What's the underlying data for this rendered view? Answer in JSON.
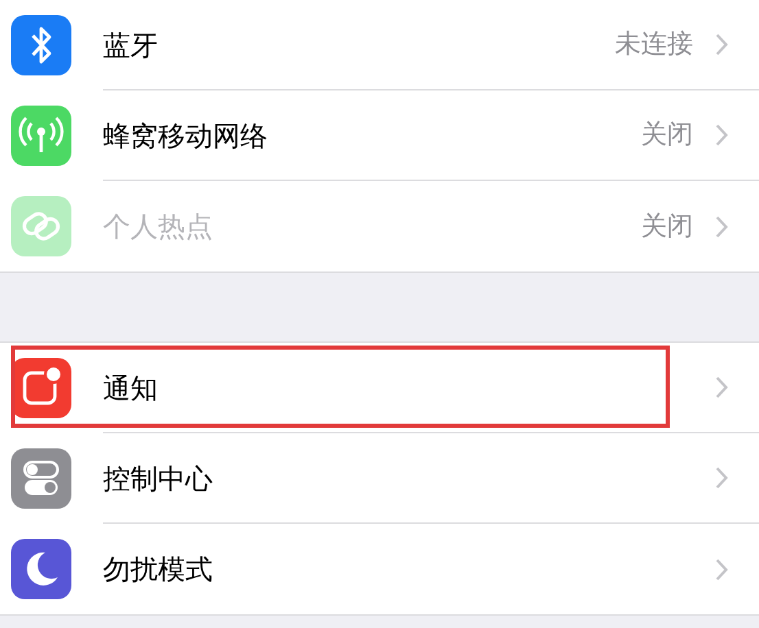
{
  "groups": [
    {
      "rows": [
        {
          "kind": "bluetooth",
          "label": "蓝牙",
          "value": "未连接",
          "disabled": false,
          "highlighted": false
        },
        {
          "kind": "cellular",
          "label": "蜂窝移动网络",
          "value": "关闭",
          "disabled": false,
          "highlighted": false
        },
        {
          "kind": "hotspot",
          "label": "个人热点",
          "value": "关闭",
          "disabled": true,
          "highlighted": false
        }
      ]
    },
    {
      "rows": [
        {
          "kind": "notifications",
          "label": "通知",
          "disabled": false,
          "highlighted": true
        },
        {
          "kind": "control",
          "label": "控制中心",
          "disabled": false,
          "highlighted": false
        },
        {
          "kind": "moon",
          "label": "勿扰模式",
          "disabled": false,
          "highlighted": false
        }
      ]
    }
  ]
}
